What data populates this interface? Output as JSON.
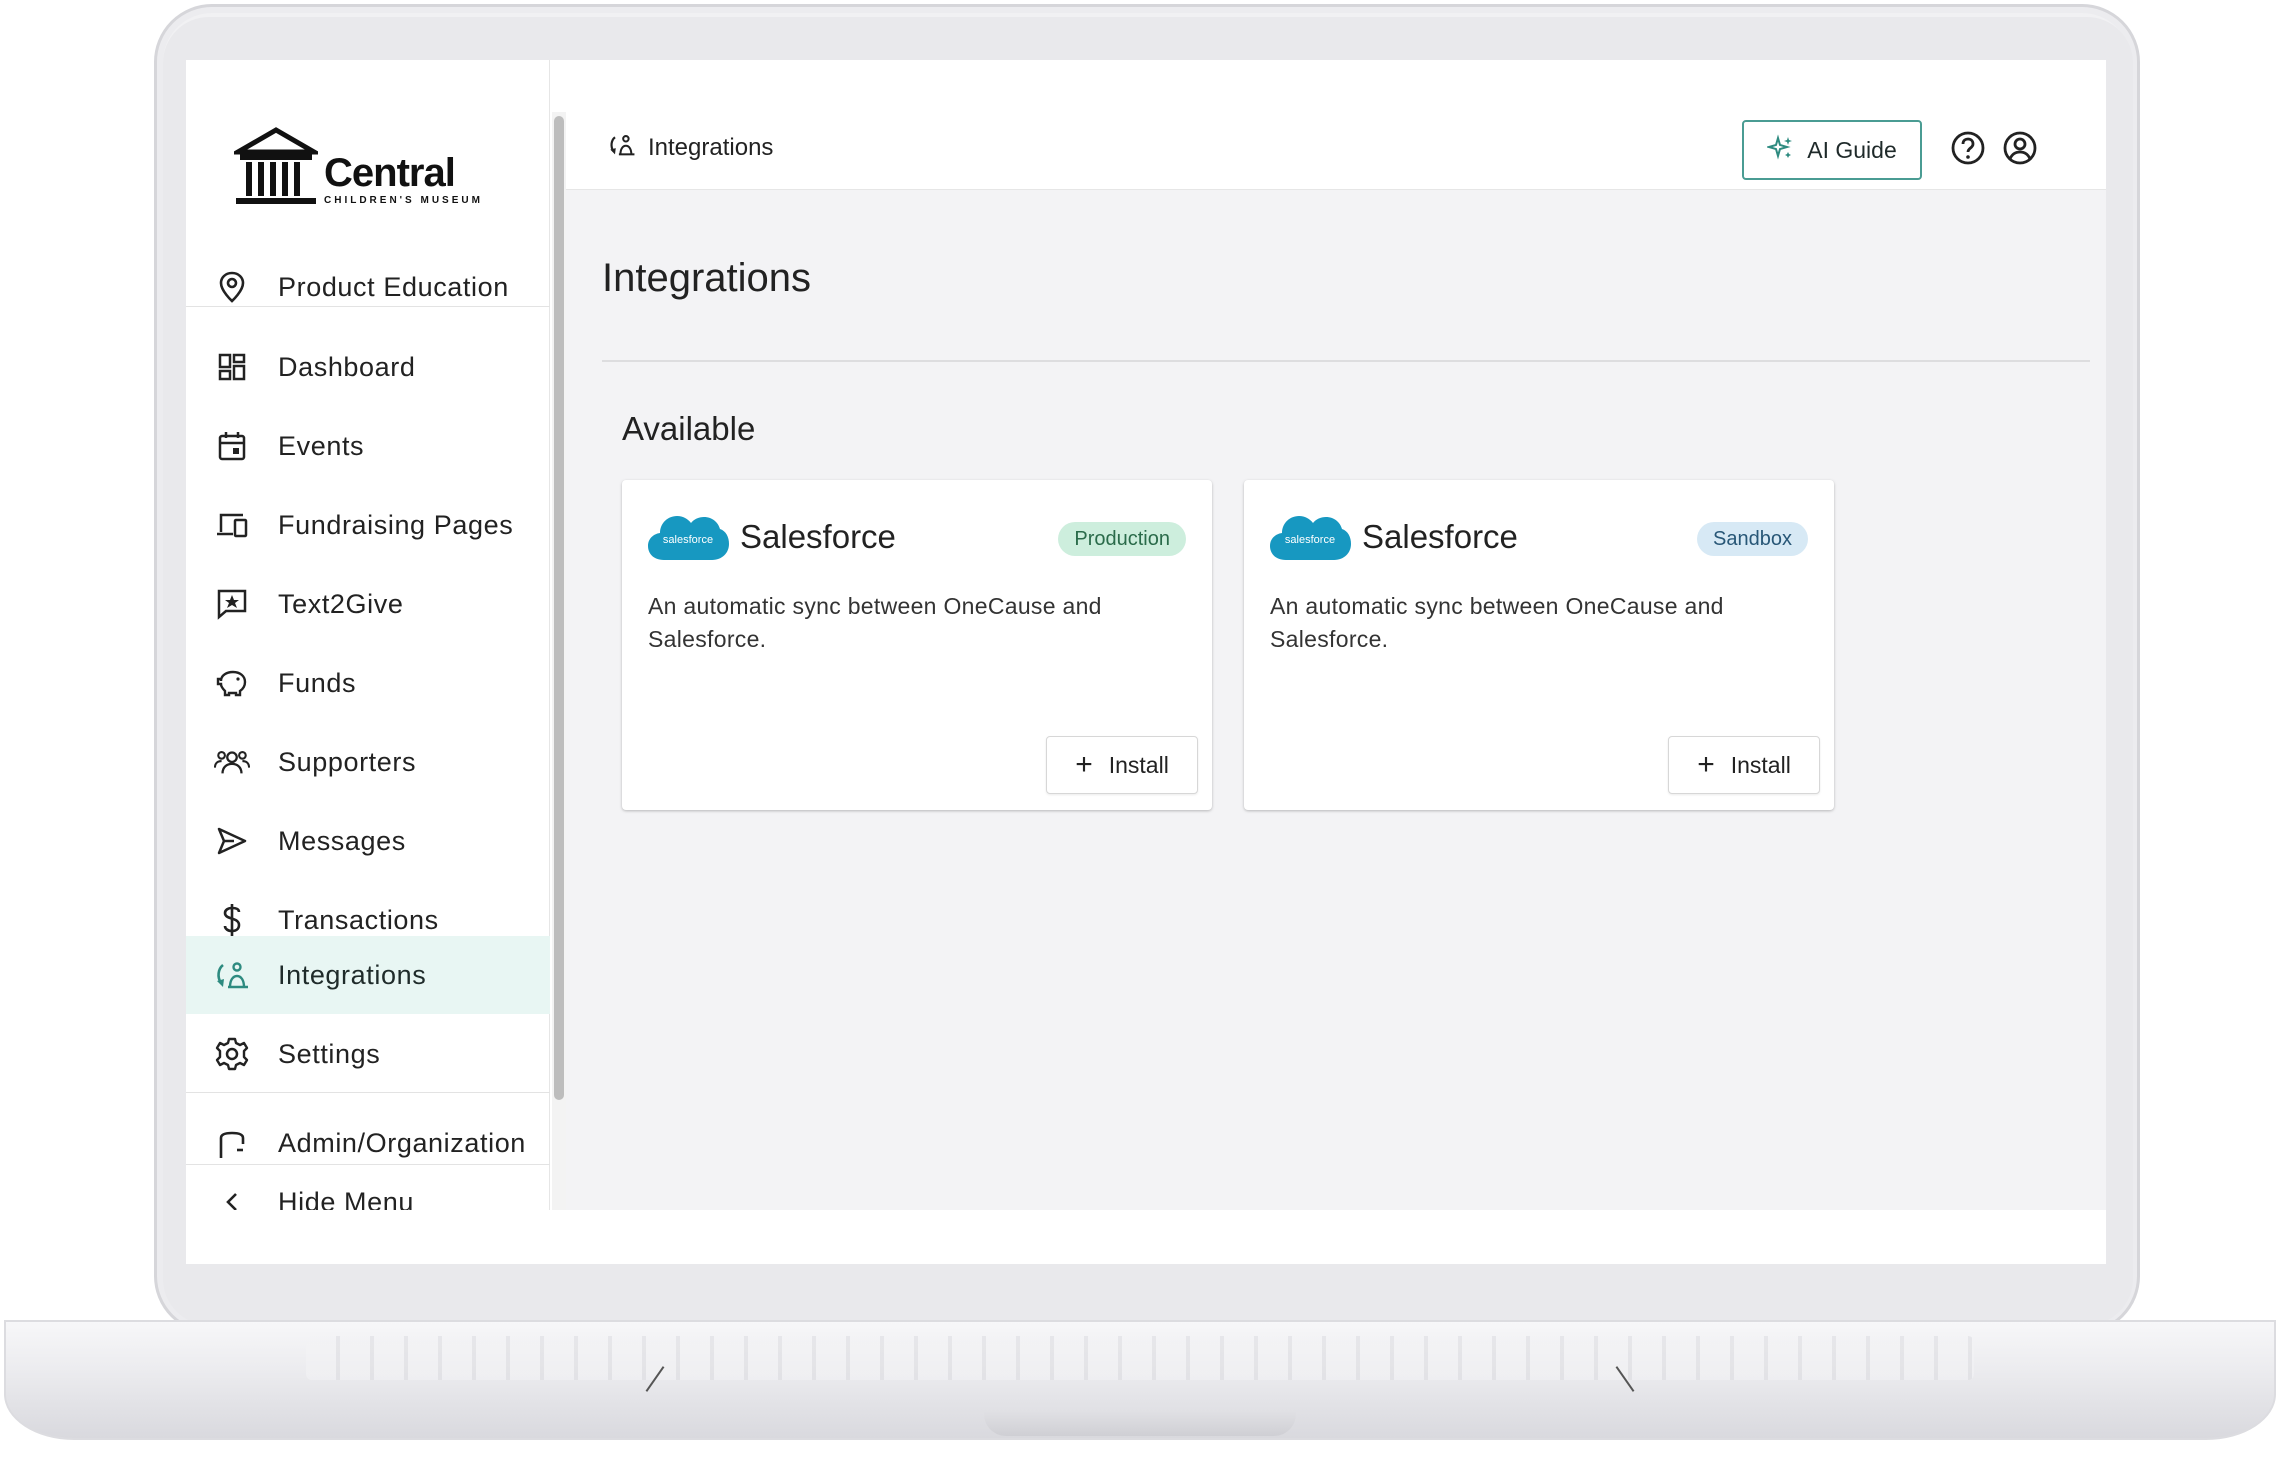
{
  "brand": {
    "name": "Central",
    "subtitle": "CHILDREN'S MUSEUM"
  },
  "sidebar": {
    "items": [
      {
        "label": "Product Education",
        "icon": "map-pin-icon"
      },
      {
        "label": "Dashboard",
        "icon": "dashboard-icon"
      },
      {
        "label": "Events",
        "icon": "calendar-icon"
      },
      {
        "label": "Fundraising Pages",
        "icon": "devices-icon"
      },
      {
        "label": "Text2Give",
        "icon": "message-star-icon"
      },
      {
        "label": "Funds",
        "icon": "piggy-bank-icon"
      },
      {
        "label": "Supporters",
        "icon": "people-icon"
      },
      {
        "label": "Messages",
        "icon": "send-icon"
      },
      {
        "label": "Transactions",
        "icon": "dollar-icon"
      },
      {
        "label": "Integrations",
        "icon": "integrations-icon",
        "active": true
      },
      {
        "label": "Settings",
        "icon": "gear-icon"
      },
      {
        "label": "Admin/Organization",
        "icon": "admin-icon"
      }
    ],
    "hide_menu": "Hide Menu"
  },
  "header": {
    "breadcrumb": "Integrations",
    "ai_guide": "AI Guide"
  },
  "page": {
    "title": "Integrations",
    "section": "Available"
  },
  "cards": [
    {
      "logo_text": "salesforce",
      "title": "Salesforce",
      "badge": "Production",
      "description": "An automatic sync between OneCause and Salesforce.",
      "action": "Install"
    },
    {
      "logo_text": "salesforce",
      "title": "Salesforce",
      "badge": "Sandbox",
      "description": "An automatic sync between OneCause and Salesforce.",
      "action": "Install"
    }
  ],
  "colors": {
    "accent": "#2e8b80",
    "active_bg": "#e8f6f3",
    "salesforce_blue": "#1798c1",
    "production_badge": "#cdeedd",
    "sandbox_badge": "#d7e9f5"
  }
}
